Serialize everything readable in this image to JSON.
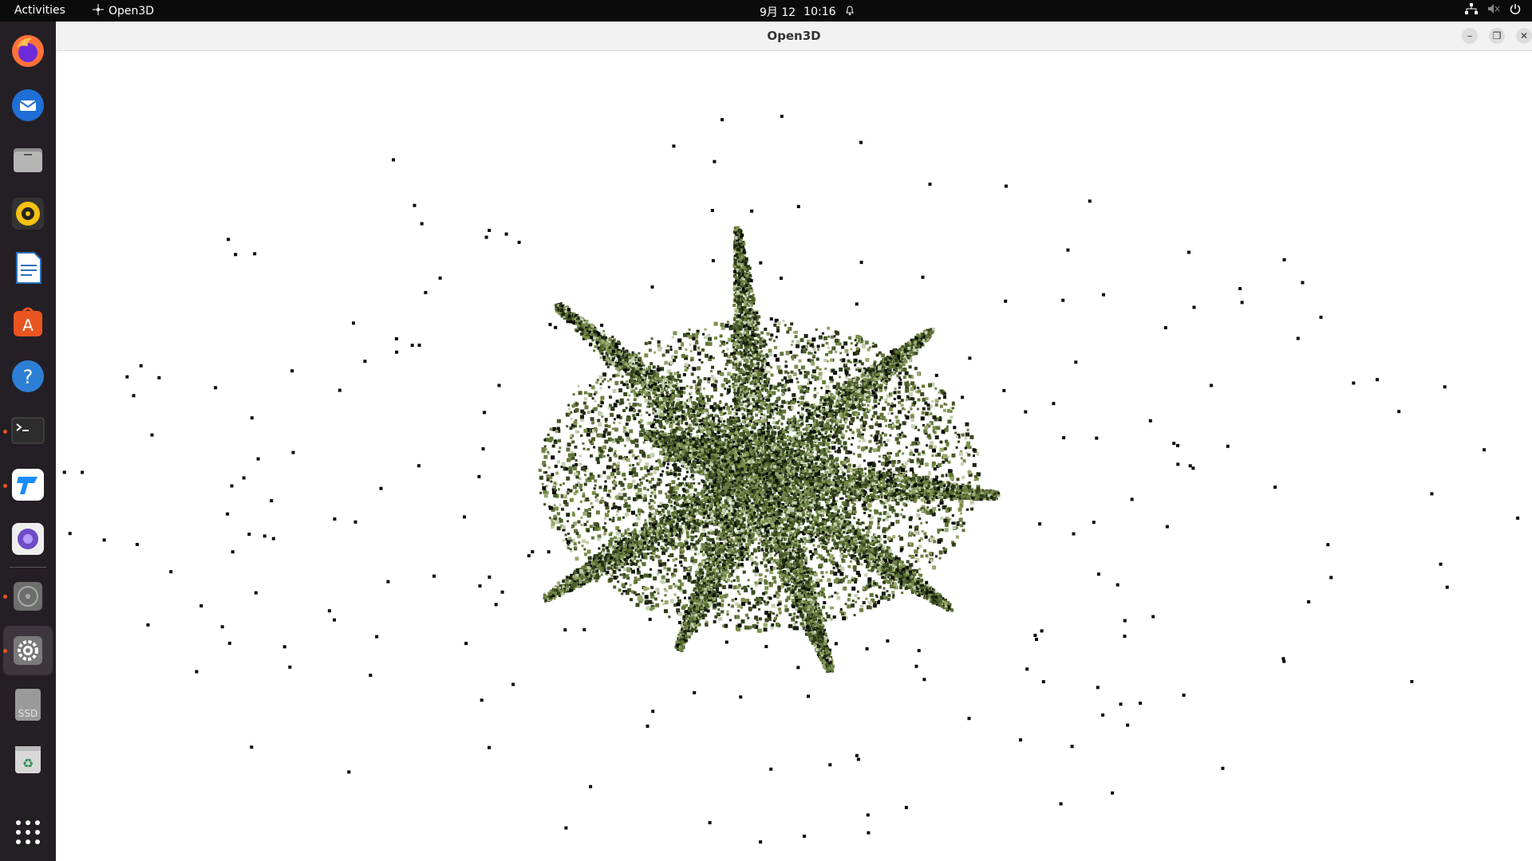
{
  "topbar": {
    "activities": "Activities",
    "app_name": "Open3D",
    "date": "9月 12",
    "time": "10:16"
  },
  "window": {
    "title": "Open3D"
  },
  "dock": {
    "items": [
      {
        "name": "firefox-icon",
        "color": "#e66000"
      },
      {
        "name": "thunderbird-icon",
        "color": "#2a7de1"
      },
      {
        "name": "files-icon",
        "color": "#9a9a9a"
      },
      {
        "name": "rhythmbox-icon",
        "color": "#f5c211"
      },
      {
        "name": "libreoffice-writer-icon",
        "color": "#2a6ebb"
      },
      {
        "name": "app-center-icon",
        "color": "#e95420"
      },
      {
        "name": "help-icon",
        "color": "#2c7fd4"
      },
      {
        "name": "terminal-icon",
        "color": "#2d2d2d"
      },
      {
        "name": "toolbox-app-icon",
        "color": "#1a8cff"
      },
      {
        "name": "screenshot-app-icon",
        "color": "#6f4bc7"
      },
      {
        "name": "disc-icon",
        "color": "#777777"
      },
      {
        "name": "settings-icon",
        "color": "#8a8a8a"
      },
      {
        "name": "ssd-drive-icon",
        "color": "#9a9a9a"
      },
      {
        "name": "trash-icon",
        "color": "#6e8f6e"
      }
    ],
    "ssd_label": "SSD"
  },
  "pointcloud": {
    "colors": [
      "#1a2410",
      "#2e3d1a",
      "#4a5e2a",
      "#5f7536",
      "#7a8f4a",
      "#98a86e",
      "#c4d0b0",
      "#0a0a0a",
      "#3b4a22",
      "#6c7f44"
    ]
  }
}
